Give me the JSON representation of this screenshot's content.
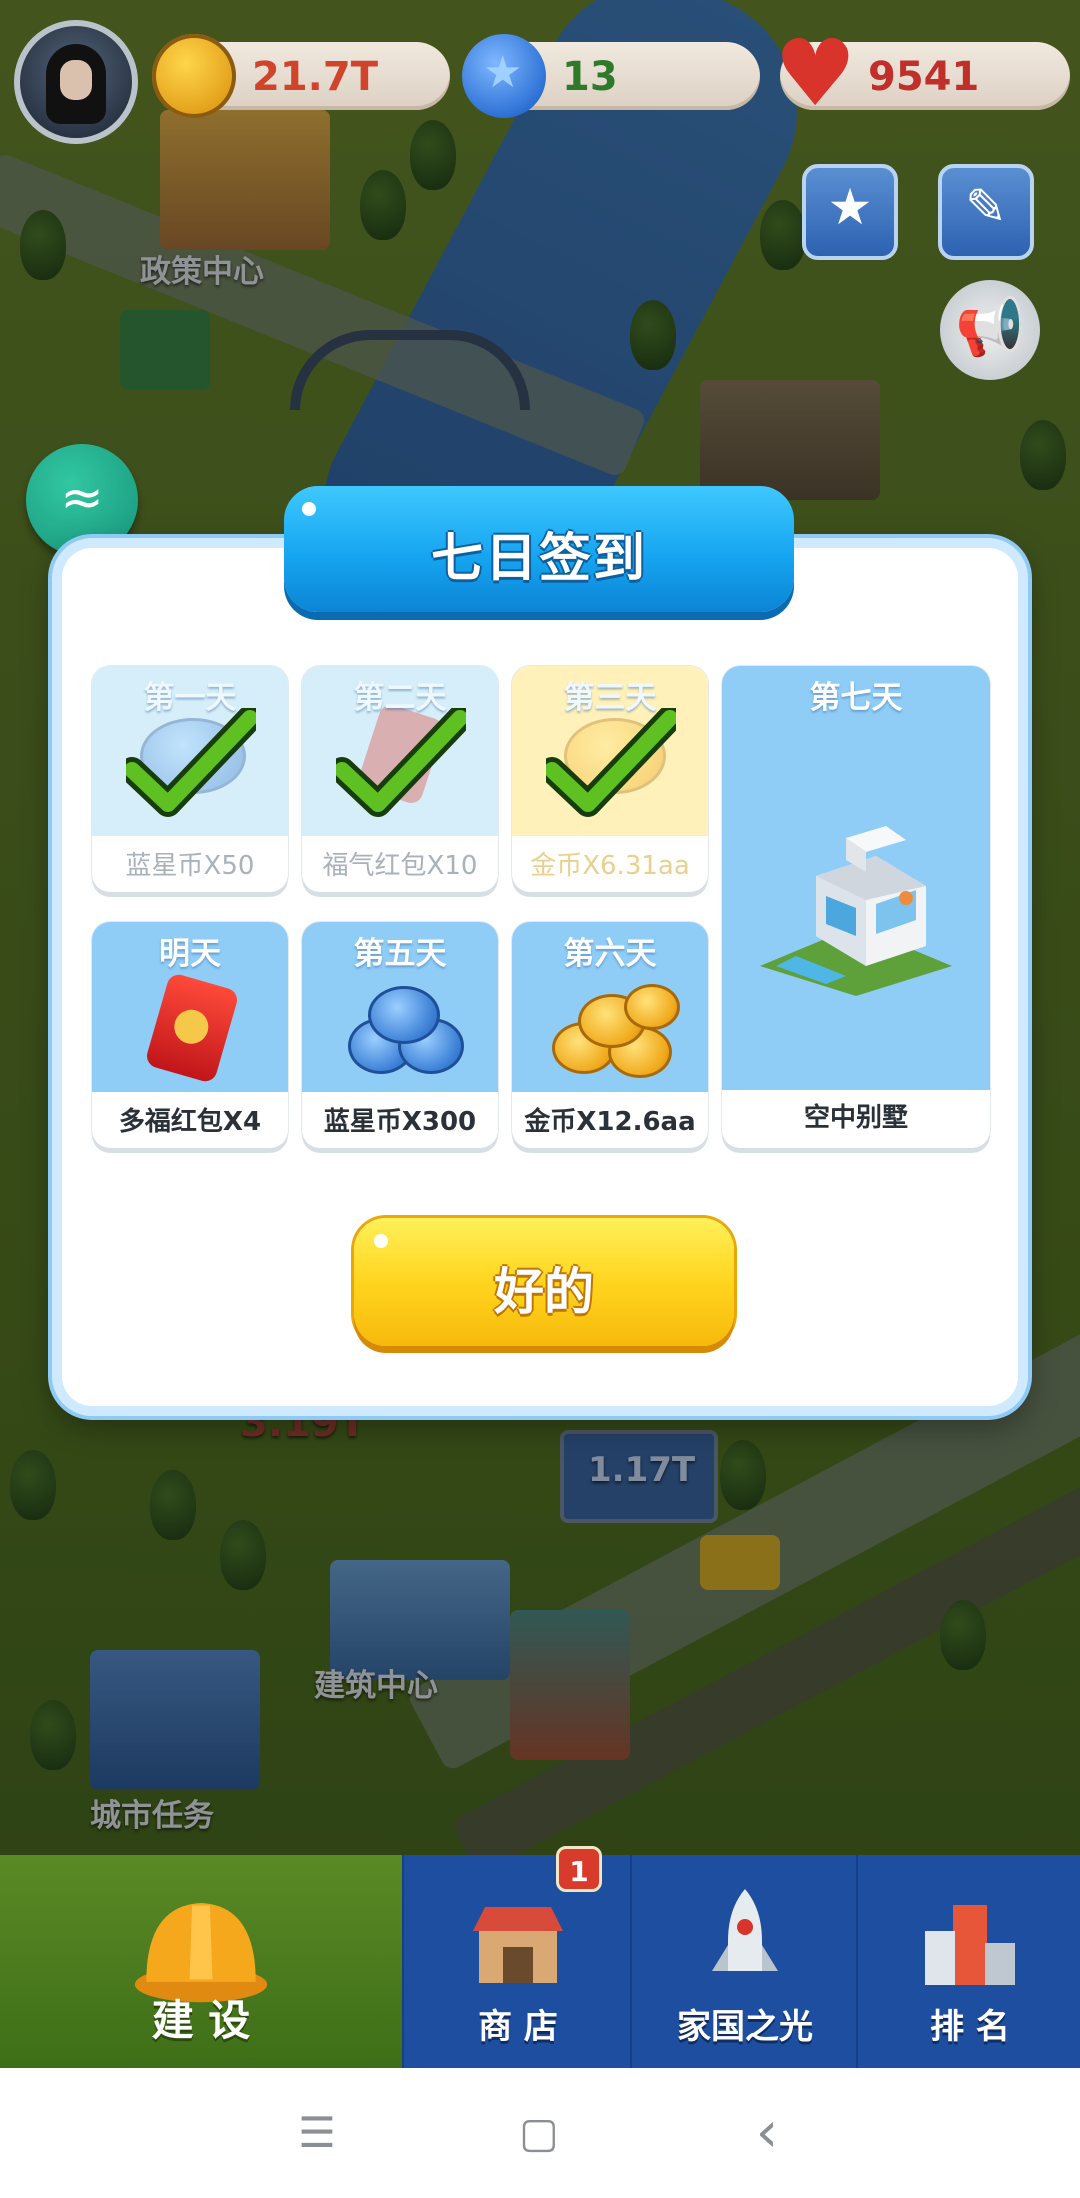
{
  "hud": {
    "coins": "21.7T",
    "stars": "13",
    "hearts": "9541",
    "colors": {
      "coins_text": "#d0442b",
      "stars_text": "#2f7a2a",
      "hearts_text": "#c0302a"
    }
  },
  "map_labels": {
    "policy_center": "政策中心",
    "building_center": "建筑中心",
    "city_tasks": "城市任务",
    "billboard_value": "1.17T",
    "floating_value": "3.19T"
  },
  "dialog": {
    "title": "七日签到",
    "days": [
      {
        "day": "第一天",
        "reward": "蓝星币X50",
        "claimed": true,
        "icon": "blue-star-coins-icon"
      },
      {
        "day": "第二天",
        "reward": "福气红包X10",
        "claimed": true,
        "icon": "red-envelope-icon"
      },
      {
        "day": "第三天",
        "reward": "金币X6.31aa",
        "claimed": true,
        "icon": "gold-coins-icon"
      },
      {
        "day": "明天",
        "reward": "多福红包X4",
        "claimed": false,
        "icon": "red-envelope-icon"
      },
      {
        "day": "第五天",
        "reward": "蓝星币X300",
        "claimed": false,
        "icon": "blue-star-coins-icon"
      },
      {
        "day": "第六天",
        "reward": "金币X12.6aa",
        "claimed": false,
        "icon": "gold-coins-icon"
      },
      {
        "day": "第七天",
        "reward": "空中别墅",
        "claimed": false,
        "icon": "villa-icon"
      }
    ],
    "ok_label": "好的"
  },
  "nav": {
    "items": [
      {
        "label": "建 设",
        "icon": "hard-hat-icon",
        "active": true
      },
      {
        "label": "商 店",
        "icon": "shop-icon",
        "active": false,
        "badge": "1"
      },
      {
        "label": "家国之光",
        "icon": "rocket-icon",
        "active": false
      },
      {
        "label": "排 名",
        "icon": "podium-icon",
        "active": false
      }
    ]
  },
  "system_bar": {
    "menu": "☰",
    "home": "▢",
    "back": "‹"
  }
}
